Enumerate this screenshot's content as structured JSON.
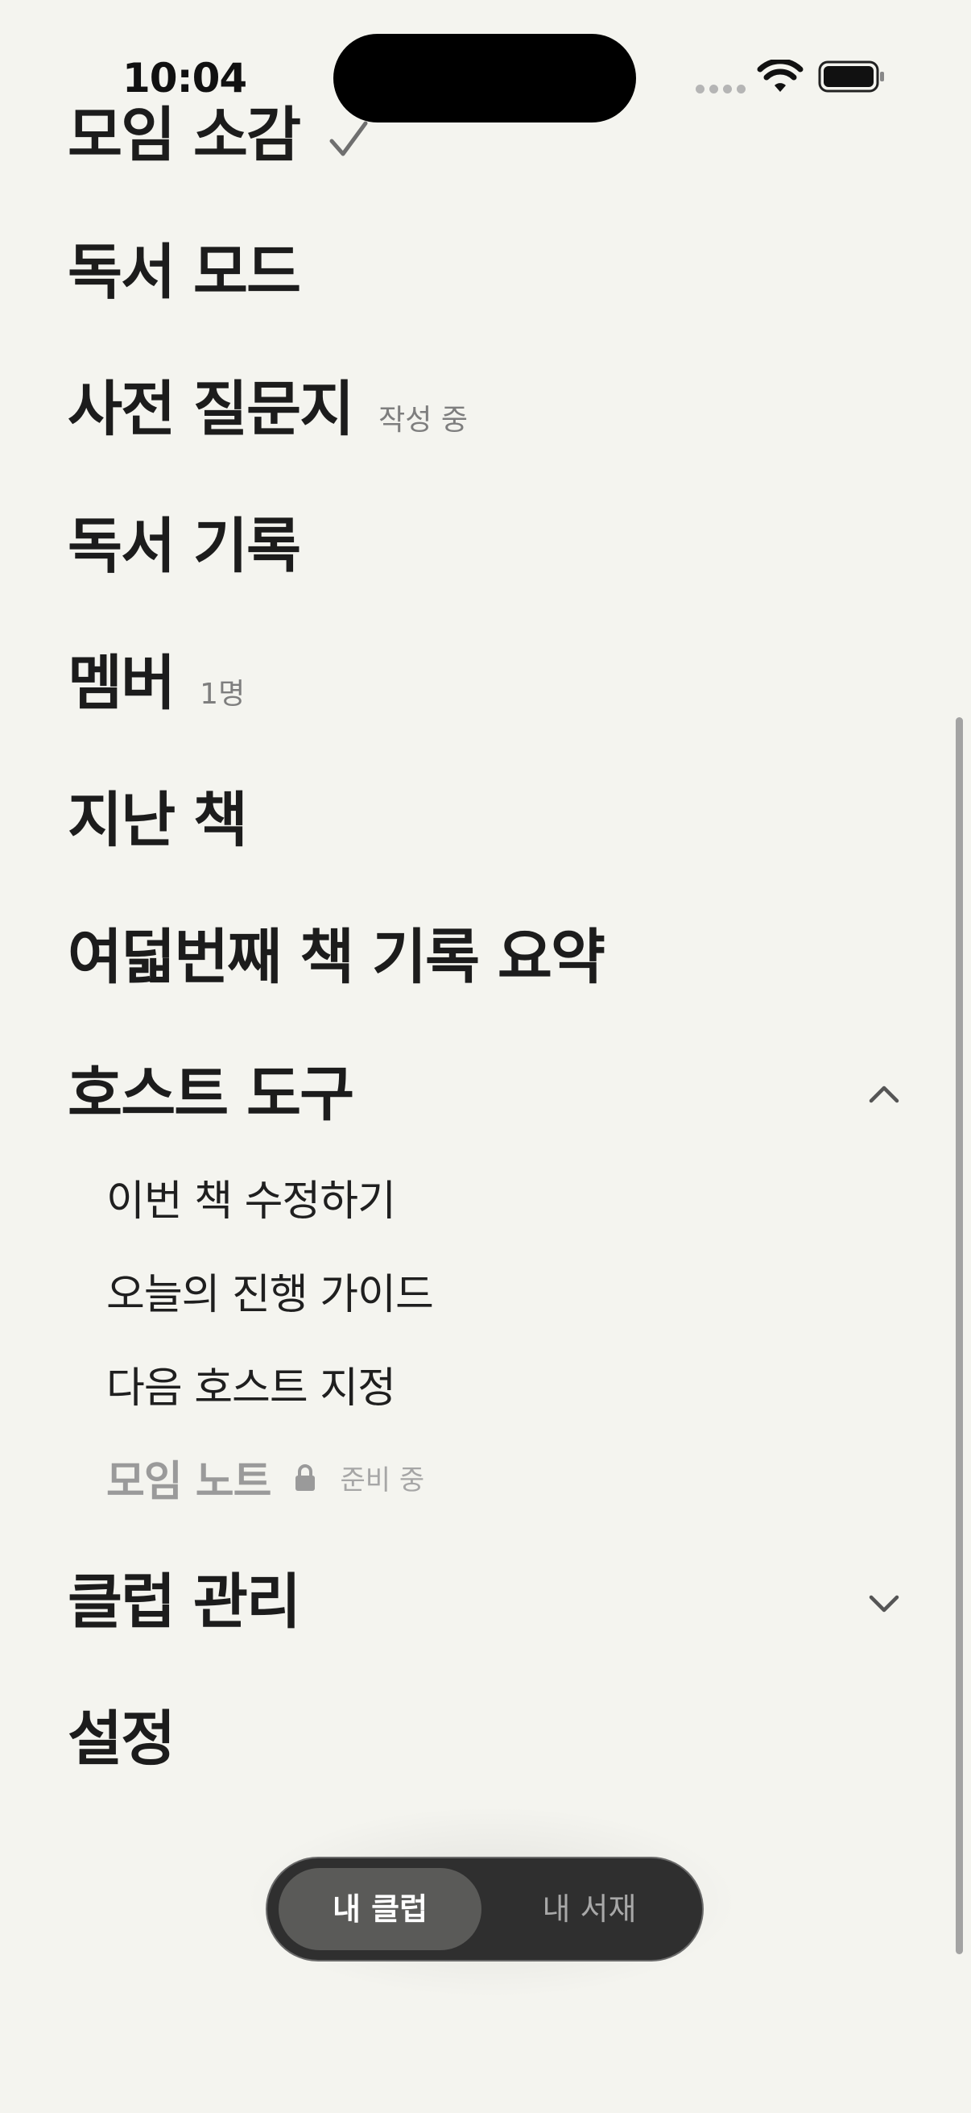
{
  "status_bar": {
    "time": "10:04"
  },
  "menu": {
    "items": [
      {
        "label": "모임 소감"
      },
      {
        "label": "독서 모드"
      },
      {
        "label": "사전 질문지",
        "note": "작성 중"
      },
      {
        "label": "독서 기록"
      },
      {
        "label": "멤버",
        "note": "1명"
      },
      {
        "label": "지난 책"
      },
      {
        "label": "여덟번째 책 기록 요약"
      },
      {
        "label": "호스트 도구"
      },
      {
        "label": "클럽 관리"
      },
      {
        "label": "설정"
      }
    ],
    "host_tools": [
      {
        "label": "이번 책 수정하기"
      },
      {
        "label": "오늘의 진행 가이드"
      },
      {
        "label": "다음 호스트 지정"
      },
      {
        "label": "모임 노트",
        "note": "준비 중"
      }
    ]
  },
  "tabs": {
    "active": "내 클럽",
    "inactive": "내 서재"
  },
  "colors": {
    "background": "#f4f4ef",
    "tab_bar": "#2f2f2f",
    "tab_active": "#5a5a58"
  }
}
